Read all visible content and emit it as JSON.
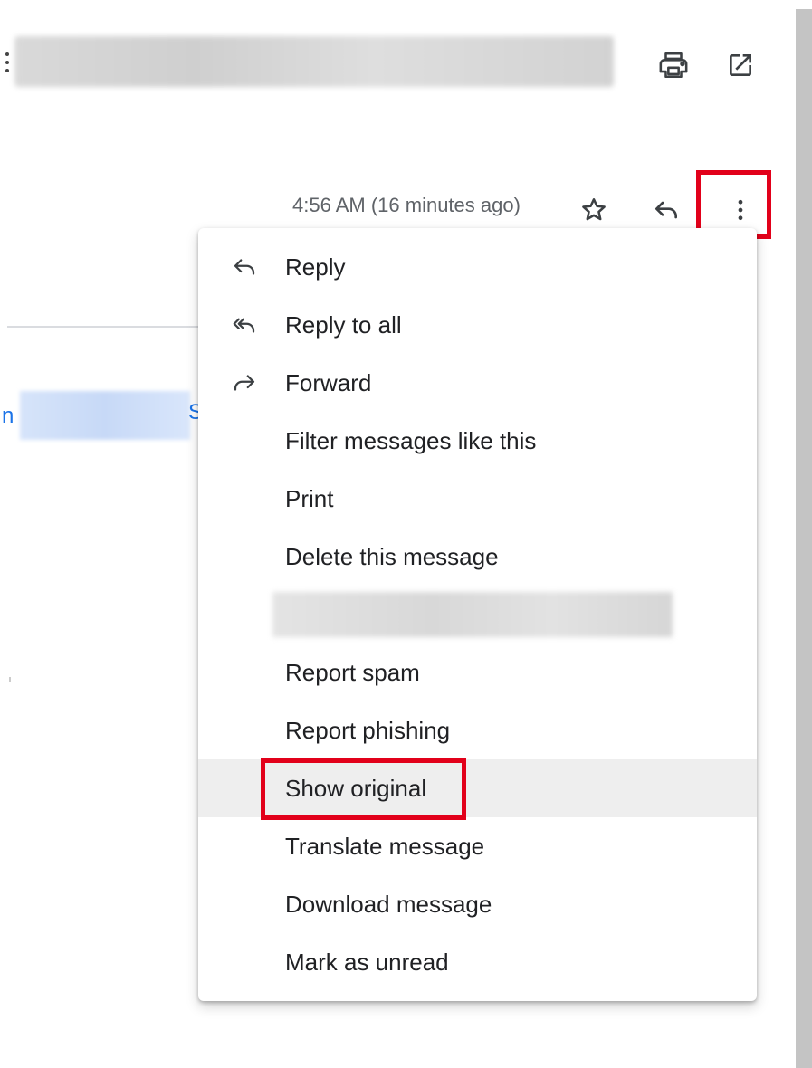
{
  "header": {
    "print_icon": "print-icon",
    "open_new_window_icon": "open-in-new-window-icon"
  },
  "message": {
    "timestamp": "4:56 AM (16 minutes ago)",
    "star_icon": "star-outline-icon",
    "reply_icon": "reply-icon",
    "more_icon": "more-vertical-icon",
    "link_fragment_left": "n",
    "link_fragment_right": "S"
  },
  "menu": {
    "items": [
      {
        "label": "Reply",
        "icon": "reply-icon"
      },
      {
        "label": "Reply to all",
        "icon": "reply-all-icon"
      },
      {
        "label": "Forward",
        "icon": "forward-icon"
      },
      {
        "label": "Filter messages like this"
      },
      {
        "label": "Print"
      },
      {
        "label": "Delete this message"
      },
      {
        "label": "Report spam"
      },
      {
        "label": "Report phishing"
      },
      {
        "label": "Show original"
      },
      {
        "label": "Translate message"
      },
      {
        "label": "Download message"
      },
      {
        "label": "Mark as unread"
      }
    ],
    "active_item": "Show original"
  },
  "colors": {
    "highlight_box": "#e2001a",
    "hover_row": "#eeeeee",
    "link": "#1a73e8",
    "secondary_text": "#5f6368"
  }
}
